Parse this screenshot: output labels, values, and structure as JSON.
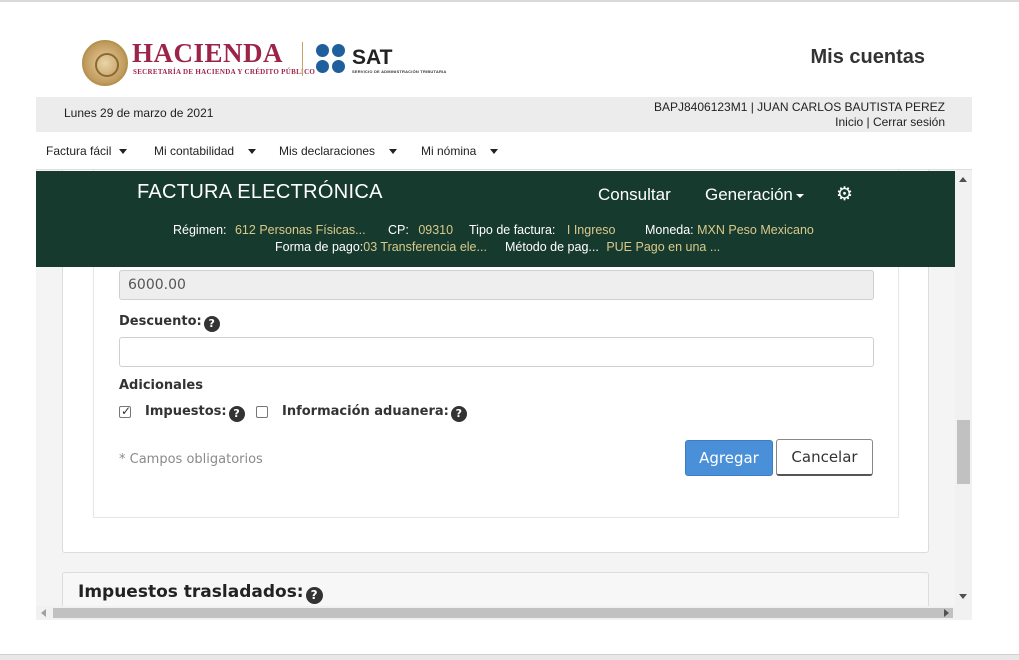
{
  "header": {
    "hacienda_title": "HACIENDA",
    "hacienda_subtitle": "SECRETARÍA DE HACIENDA Y CRÉDITO PÚBLICO",
    "sat_title": "SAT",
    "sat_subtitle": "SERVICIO DE ADMINISTRACIÓN TRIBUTARIA",
    "page_title": "Mis cuentas"
  },
  "userbar": {
    "date": "Lunes 29 de marzo de 2021",
    "user": "BAPJ8406123M1 | JUAN CARLOS BAUTISTA PEREZ",
    "link_inicio": "Inicio",
    "separator": "|",
    "link_cerrar": "Cerrar sesión"
  },
  "nav": {
    "items": [
      {
        "label": "Factura fácil"
      },
      {
        "label": "Mi contabilidad"
      },
      {
        "label": "Mis declaraciones"
      },
      {
        "label": "Mi nómina"
      }
    ]
  },
  "banner": {
    "title": "FACTURA ELECTRÓNICA",
    "consultar": "Consultar",
    "generacion": "Generación",
    "settings_icon": "gear-icon",
    "regimen_label": "Régimen:",
    "regimen_value": "612 Personas Físicas...",
    "cp_label": "CP:",
    "cp_value": "09310",
    "tipo_label": "Tipo de factura:",
    "tipo_value": "I Ingreso",
    "moneda_label": "Moneda:",
    "moneda_value": "MXN Peso Mexicano",
    "forma_label": "Forma de pago:",
    "forma_value": "03 Transferencia ele...",
    "metodo_label": "Método de pag...",
    "metodo_value": "PUE Pago en una ..."
  },
  "form": {
    "readonly_value": "6000.00",
    "descuento_label": "Descuento:",
    "descuento_value": "",
    "adicionales_label": "Adicionales",
    "impuestos_label": "Impuestos:",
    "impuestos_checked": true,
    "aduanera_label": "Información aduanera:",
    "aduanera_checked": false,
    "required_note": "* Campos obligatorios",
    "agregar_button": "Agregar",
    "cancelar_button": "Cancelar",
    "help_glyph": "?"
  },
  "section2": {
    "title": "Impuestos trasladados:"
  },
  "colors": {
    "banner_bg": "#173a2f",
    "banner_value": "#d8c98a",
    "hacienda": "#9d2449",
    "sat_blue": "#1f5f9e",
    "primary_button": "#4a90d9"
  }
}
